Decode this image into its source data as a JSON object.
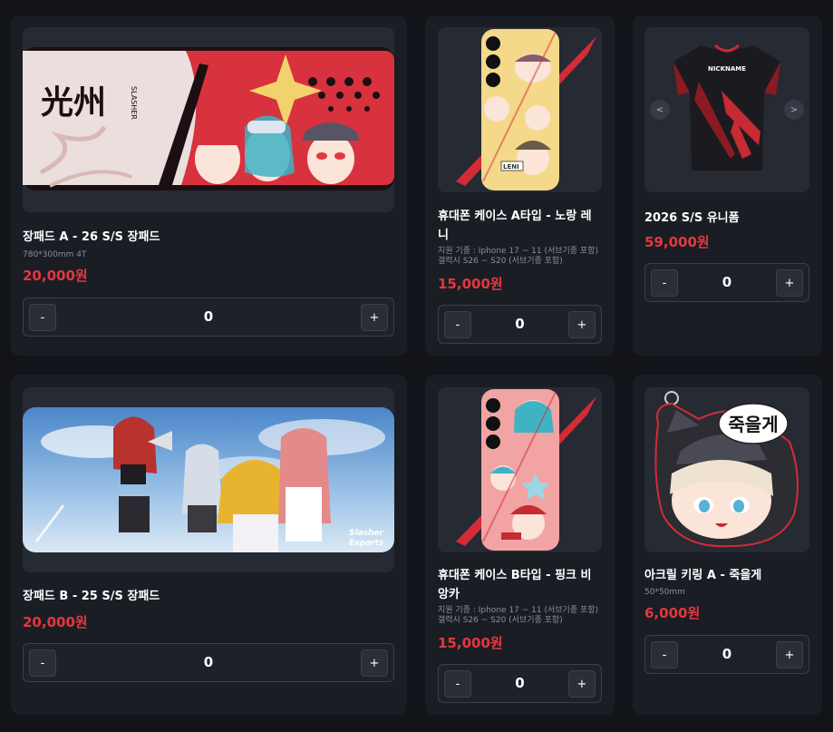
{
  "colors": {
    "background": "#121419",
    "card": "#1a1d24",
    "image_bg": "#252a33",
    "price": "#e5373f",
    "accent_red": "#d42b37"
  },
  "products": [
    {
      "title": "장패드 A - 26 S/S 장패드",
      "spec": "780*300mm 4T",
      "price": "20,000원",
      "qty": {
        "minus": "-",
        "value": "0",
        "plus": "+"
      },
      "image": {
        "logo_text": "光州",
        "brand_text": "SLASHER"
      }
    },
    {
      "title_line1": "휴대폰 케이스 A타입 - 노랑 레",
      "title_line2": "니",
      "spec_line1": "지원 기종 : Iphone 17 ~ 11 (서브기종 포함)",
      "spec_line2": "갤럭시 S26 ~ S20 (서브기종 포함)",
      "price": "15,000원",
      "qty": {
        "minus": "-",
        "value": "0",
        "plus": "+"
      },
      "image": {
        "sticker_text": "LENI"
      }
    },
    {
      "title": "2026 S/S 유니폼",
      "price": "59,000원",
      "qty": {
        "minus": "-",
        "value": "0",
        "plus": "+"
      },
      "image": {
        "jersey_text": "NICKNAME",
        "prev": "<",
        "next": ">"
      }
    },
    {
      "title": "장패드 B - 25 S/S 장패드",
      "price": "20,000원",
      "qty": {
        "minus": "-",
        "value": "0",
        "plus": "+"
      },
      "image": {
        "brand_line1": "Slasher",
        "brand_line2": "Esports"
      }
    },
    {
      "title_line1": "휴대폰 케이스 B타입 - 핑크 비",
      "title_line2": "앙카",
      "spec_line1": "지원 기종 : Iphone 17 ~ 11 (서브기종 포함)",
      "spec_line2": "갤럭시 S26 ~ S20 (서브기종 포함)",
      "price": "15,000원",
      "qty": {
        "minus": "-",
        "value": "0",
        "plus": "+"
      },
      "image": {}
    },
    {
      "title": "아크릴 키링 A - 죽을게",
      "spec": "50*50mm",
      "price": "6,000원",
      "qty": {
        "minus": "-",
        "value": "0",
        "plus": "+"
      },
      "image": {
        "speech": "죽을게"
      }
    }
  ]
}
